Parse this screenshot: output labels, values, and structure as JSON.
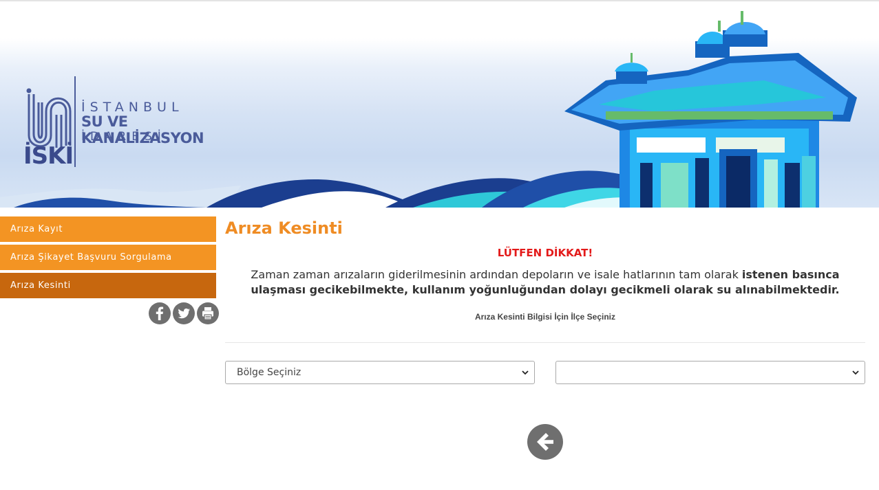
{
  "logo": {
    "line1": "İSTANBUL",
    "line2": "SU VE KANALİZASYON",
    "line3": "İDARESİ",
    "word": "İSKİ"
  },
  "sidebar": {
    "items": [
      {
        "label": "Arıza Kayıt",
        "active": false
      },
      {
        "label": "Arıza Şikayet Başvuru Sorgulama",
        "active": false
      },
      {
        "label": "Arıza Kesinti",
        "active": true
      }
    ]
  },
  "social": [
    "facebook-icon",
    "twitter-icon",
    "print-icon"
  ],
  "main": {
    "title": "Arıza Kesinti",
    "warning_title": "LÜTFEN DİKKAT!",
    "notice_plain": "Zaman zaman arızaların giderilmesinin ardından depoların ve isale hatlarının tam olarak ",
    "notice_bold": "istenen basınca ulaşması gecikebilmekte, kullanım yoğunluğundan dolayı gecikmeli olarak su alınabilmektedir.",
    "select_hint": "Arıza Kesinti Bilgisi İçin İlçe Seçiniz",
    "region_select": {
      "value": "Bölge Seçiniz"
    },
    "district_select": {
      "value": ""
    }
  },
  "back_button": {
    "icon": "arrow-left-icon"
  },
  "colors": {
    "accent": "#f39423",
    "accent_active": "#c7670e",
    "title": "#ef8c24",
    "warning": "#e31a1a",
    "icon_gray": "#6f6f6f"
  }
}
